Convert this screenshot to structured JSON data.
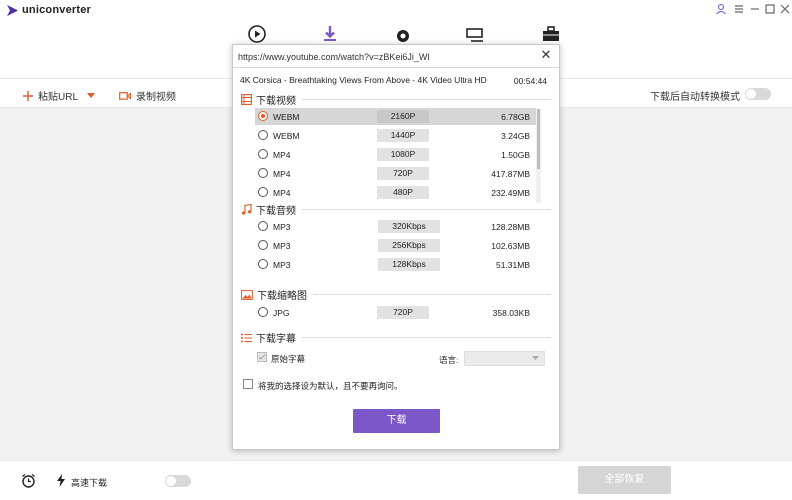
{
  "app": {
    "name": "uniconverter"
  },
  "toolbar": {
    "paste_url": "粘贴URL",
    "record_video": "录制视频",
    "auto_convert": "下载后自动转换模式"
  },
  "bottom": {
    "high_speed": "高速下载",
    "resume_all": "全部恢复"
  },
  "dialog": {
    "url": "https://www.youtube.com/watch?v=zBKei6Ji_WI",
    "video_title": "4K Corsica - Breathtaking Views From Above - 4K Video Ultra HD",
    "duration": "00:54:44",
    "sections": {
      "video": "下载视频",
      "audio": "下载音频",
      "thumbnail": "下载缩略图",
      "subtitle": "下载字幕"
    },
    "video_rows": [
      {
        "format": "WEBM",
        "res": "2160P",
        "size": "6.78GB",
        "selected": true
      },
      {
        "format": "WEBM",
        "res": "1440P",
        "size": "3.24GB",
        "selected": false
      },
      {
        "format": "MP4",
        "res": "1080P",
        "size": "1.50GB",
        "selected": false
      },
      {
        "format": "MP4",
        "res": "720P",
        "size": "417.87MB",
        "selected": false
      },
      {
        "format": "MP4",
        "res": "480P",
        "size": "232.49MB",
        "selected": false
      }
    ],
    "audio_rows": [
      {
        "format": "MP3",
        "res": "320Kbps",
        "size": "128.28MB"
      },
      {
        "format": "MP3",
        "res": "256Kbps",
        "size": "102.63MB"
      },
      {
        "format": "MP3",
        "res": "128Kbps",
        "size": "51.31MB"
      }
    ],
    "thumb_rows": [
      {
        "format": "JPG",
        "res": "720P",
        "size": "358.03KB"
      }
    ],
    "subtitle_original": "原始字幕",
    "language_label": "语言:",
    "remember_choice": "将我的选择设为默认，且不要再询问。",
    "download_button": "下载"
  },
  "colors": {
    "accent": "#7b57c8",
    "radio_selected": "#e05a2a",
    "toolbar_icon": "#e05a2a"
  }
}
